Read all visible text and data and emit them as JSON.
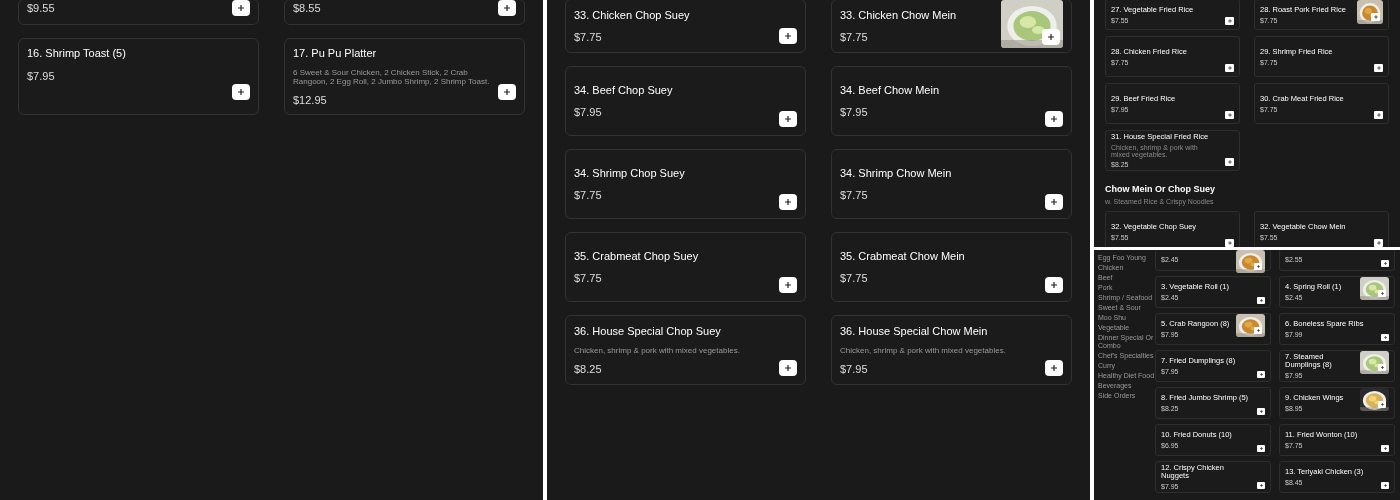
{
  "view_1": {
    "items": [
      {
        "price": "$9.55",
        "photo": false
      },
      {
        "price": "$8.55",
        "photo": false
      },
      {
        "name": "16. Shrimp Toast (5)",
        "price": "$7.95",
        "photo": false
      },
      {
        "name": "17. Pu Pu Platter",
        "description": "6 Sweet & Sour Chicken, 2 Chicken Stick, 2 Crab Rangoon, 2 Egg Roll, 2 Jumbo Shrimp, 2 Shrimp Toast.",
        "price": "$12.95",
        "photo": false
      }
    ]
  },
  "view_2": {
    "items": [
      {
        "name": "33. Chicken Chop Suey",
        "price": "$7.75",
        "photo": false
      },
      {
        "name": "33. Chicken Chow Mein",
        "price": "$7.75",
        "photo": true
      },
      {
        "name": "34. Beef Chop Suey",
        "price": "$7.95",
        "photo": false
      },
      {
        "name": "34. Beef Chow Mein",
        "price": "$7.95",
        "photo": false
      },
      {
        "name": "34. Shrimp Chop Suey",
        "price": "$7.75",
        "photo": false
      },
      {
        "name": "34. Shrimp Chow Mein",
        "price": "$7.75",
        "photo": false
      },
      {
        "name": "35. Crabmeat Chop Suey",
        "price": "$7.75",
        "photo": false
      },
      {
        "name": "35. Crabmeat Chow Mein",
        "price": "$7.75",
        "photo": false
      },
      {
        "name": "36. House Special Chop Suey",
        "description": "Chicken, shrimp & pork with mixed vegetables.",
        "price": "$8.25",
        "photo": false
      },
      {
        "name": "36. House Special Chow Mein",
        "description": "Chicken, shrimp & pork with mixed vegetables.",
        "price": "$7.95",
        "photo": false
      }
    ]
  },
  "view_3": {
    "items": [
      {
        "name": "27. Vegetable Fried Rice",
        "price": "$7.55",
        "photo": false
      },
      {
        "name": "28. Roast Pork Fried Rice",
        "price": "$7.75",
        "photo": true
      },
      {
        "name": "28. Chicken Fried Rice",
        "price": "$7.75",
        "photo": false
      },
      {
        "name": "29. Shrimp Fried Rice",
        "price": "$7.75",
        "photo": false
      },
      {
        "name": "29. Beef Fried Rice",
        "price": "$7.95",
        "photo": false
      },
      {
        "name": "30. Crab Meat Fried Rice",
        "price": "$7.75",
        "photo": false
      },
      {
        "name": "31. House Special Fried Rice",
        "description": "Chicken, shrimp & pork with mixed vegetables.",
        "price": "$8.25",
        "photo": false
      }
    ],
    "section": {
      "title": "Chow Mein Or Chop Suey",
      "subtitle": "w. Steamed Rice & Crispy Noodles",
      "items": [
        {
          "name": "32. Vegetable Chop Suey",
          "price": "$7.55",
          "photo": false
        },
        {
          "name": "32. Vegetable Chow Mein",
          "price": "$7.55",
          "photo": false
        }
      ]
    }
  },
  "view_4": {
    "sidebar": [
      "Egg Foo Young",
      "Chicken",
      "Beef",
      "Pork",
      "Shrimp / Seafood",
      "Sweet & Sour",
      "Moo Shu",
      "Vegetable",
      "Dinner Special Or Combo",
      "Chef's Specialties",
      "Curry",
      "Healthy Diet Food",
      "Beverages",
      "Side Orders"
    ],
    "items": [
      {
        "price": "$2.45",
        "photo": true
      },
      {
        "price": "$2.55",
        "photo": false
      },
      {
        "name": "3. Vegetable Roll (1)",
        "price": "$2.45",
        "photo": false
      },
      {
        "name": "4. Spring Roll (1)",
        "price": "$2.45",
        "photo": true
      },
      {
        "name": "5. Crab Rangoon (8)",
        "price": "$7.95",
        "photo": true
      },
      {
        "name": "6. Boneless Spare Ribs",
        "price": "$7.99",
        "photo": false
      },
      {
        "name": "7. Fried Dumplings (8)",
        "price": "$7.95",
        "photo": false
      },
      {
        "name": "7. Steamed Dumplings (8)",
        "price": "$7.95",
        "photo": true
      },
      {
        "name": "8. Fried Jumbo Shrimp (5)",
        "price": "$8.25",
        "photo": false
      },
      {
        "name": "9. Chicken Wings",
        "price": "$8.95",
        "photo": true
      },
      {
        "name": "10. Fried Donuts (10)",
        "price": "$6.95",
        "photo": false
      },
      {
        "name": "11. Fried Wonton (10)",
        "price": "$7.75",
        "photo": false
      },
      {
        "name": "12. Crispy Chicken Nuggets",
        "price": "$7.95",
        "photo": false
      },
      {
        "name": "13. Teriyaki Chicken (3)",
        "price": "$8.45",
        "photo": false
      }
    ]
  }
}
